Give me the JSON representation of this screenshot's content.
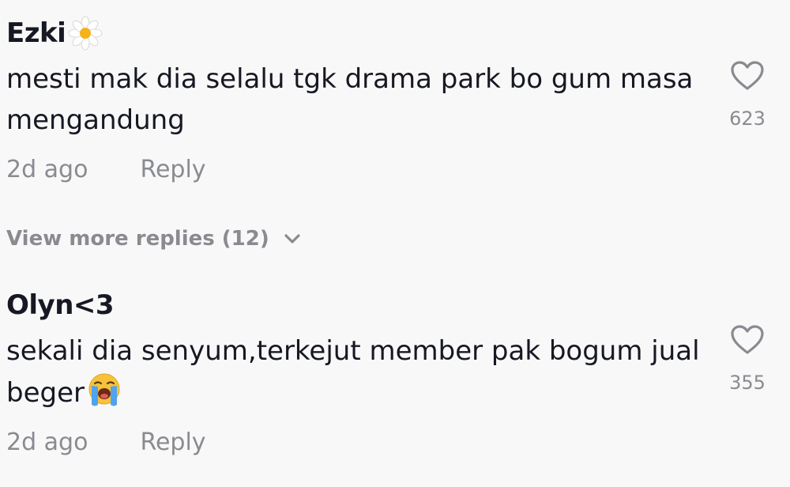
{
  "comments": [
    {
      "username": "Ezki",
      "username_emoji": "daisy-icon",
      "text": "mesti mak dia selalu tgk drama park bo gum masa mengandung",
      "time": "2d ago",
      "reply_label": "Reply",
      "like_count": "623"
    },
    {
      "username": "Olyn<3",
      "text": "sekali dia senyum,terkejut member pak bogum jual beger",
      "text_emoji": "crying-face-icon",
      "time": "2d ago",
      "reply_label": "Reply",
      "like_count": "355"
    }
  ],
  "view_more_replies": "View more replies (12)",
  "colors": {
    "background": "#f8f8f8",
    "text": "#161823",
    "muted": "#8a8b91"
  }
}
